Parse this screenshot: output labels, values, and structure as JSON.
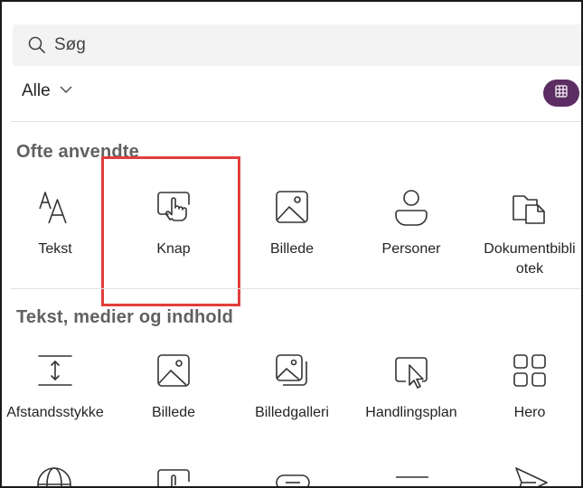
{
  "search": {
    "placeholder": "Søg",
    "icon": "search-icon"
  },
  "filter": {
    "selected": "Alle"
  },
  "view_toggle": {
    "icon": "grid-icon",
    "color": "#5c2d62"
  },
  "sections": [
    {
      "title": "Ofte anvendte",
      "items": [
        {
          "label": "Tekst",
          "icon": "text-icon"
        },
        {
          "label": "Knap",
          "icon": "button-icon"
        },
        {
          "label": "Billede",
          "icon": "image-icon"
        },
        {
          "label": "Personer",
          "icon": "people-icon"
        },
        {
          "label": "Dokumentbibliotek",
          "label_lines": [
            "Dokumentbibli",
            "otek"
          ],
          "icon": "document-library-icon"
        }
      ]
    },
    {
      "title": "Tekst, medier og indhold",
      "items": [
        {
          "label": "Afstandsstykke",
          "icon": "spacer-icon"
        },
        {
          "label": "Billede",
          "icon": "image-icon"
        },
        {
          "label": "Billedgalleri",
          "icon": "image-gallery-icon"
        },
        {
          "label": "Handlingsplan",
          "icon": "call-to-action-icon"
        },
        {
          "label": "Hero",
          "icon": "hero-icon"
        }
      ]
    }
  ],
  "highlight_color": "#e23d3d"
}
